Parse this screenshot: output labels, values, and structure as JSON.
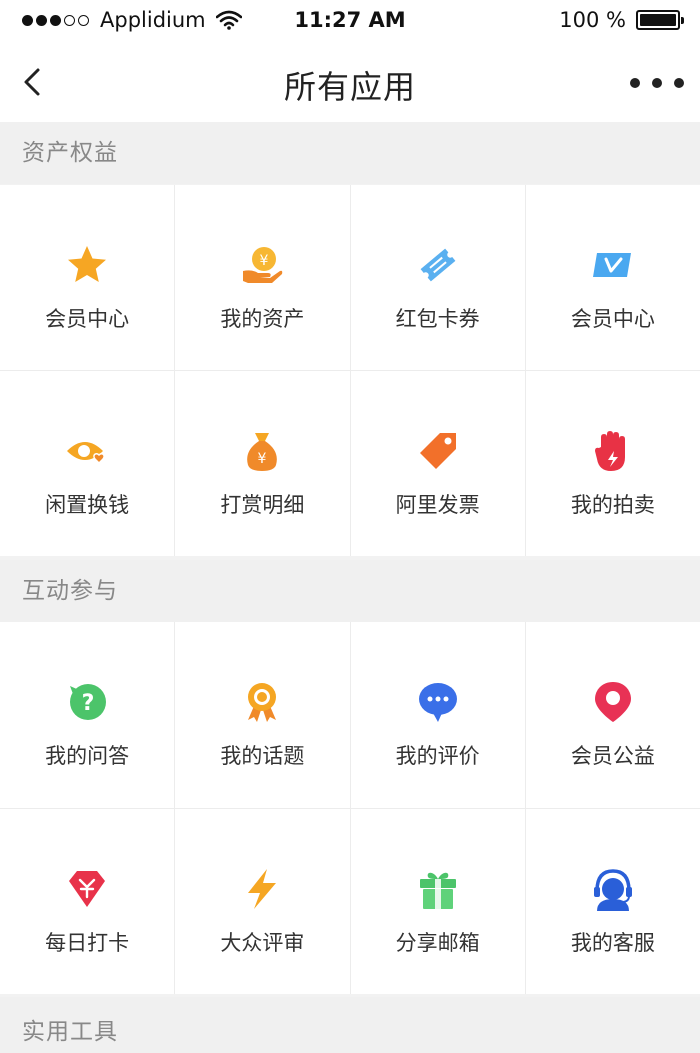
{
  "status_bar": {
    "carrier": "Applidium",
    "time": "11:27 AM",
    "battery": "100 %"
  },
  "nav": {
    "title": "所有应用"
  },
  "sections": [
    {
      "title": "资产权益",
      "items": [
        {
          "label": "会员中心",
          "icon": "star-icon",
          "color": "#f6a623"
        },
        {
          "label": "我的资产",
          "icon": "coin-hand-icon",
          "color": "#f5a623"
        },
        {
          "label": "红包卡券",
          "icon": "ticket-icon",
          "color": "#5ab0f0"
        },
        {
          "label": "会员中心",
          "icon": "v-card-icon",
          "color": "#4aa8f0"
        },
        {
          "label": "闲置换钱",
          "icon": "eye-heart-icon",
          "color": "#f5a623"
        },
        {
          "label": "打赏明细",
          "icon": "money-bag-icon",
          "color": "#f08a2a"
        },
        {
          "label": "阿里发票",
          "icon": "tag-icon",
          "color": "#f2702a"
        },
        {
          "label": "我的拍卖",
          "icon": "hand-icon",
          "color": "#e83245"
        }
      ]
    },
    {
      "title": "互动参与",
      "items": [
        {
          "label": "我的问答",
          "icon": "question-bubble-icon",
          "color": "#4cc46a"
        },
        {
          "label": "我的话题",
          "icon": "medal-icon",
          "color": "#f5a623"
        },
        {
          "label": "我的评价",
          "icon": "chat-bubble-icon",
          "color": "#3a6fe8"
        },
        {
          "label": "会员公益",
          "icon": "location-pin-icon",
          "color": "#e83255"
        },
        {
          "label": "每日打卡",
          "icon": "diamond-icon",
          "color": "#e8324a"
        },
        {
          "label": "大众评审",
          "icon": "lightning-icon",
          "color": "#f5a623"
        },
        {
          "label": "分享邮箱",
          "icon": "gift-icon",
          "color": "#4cc46a"
        },
        {
          "label": "我的客服",
          "icon": "headset-icon",
          "color": "#2a5fd8"
        }
      ]
    },
    {
      "title": "实用工具",
      "items": []
    }
  ]
}
